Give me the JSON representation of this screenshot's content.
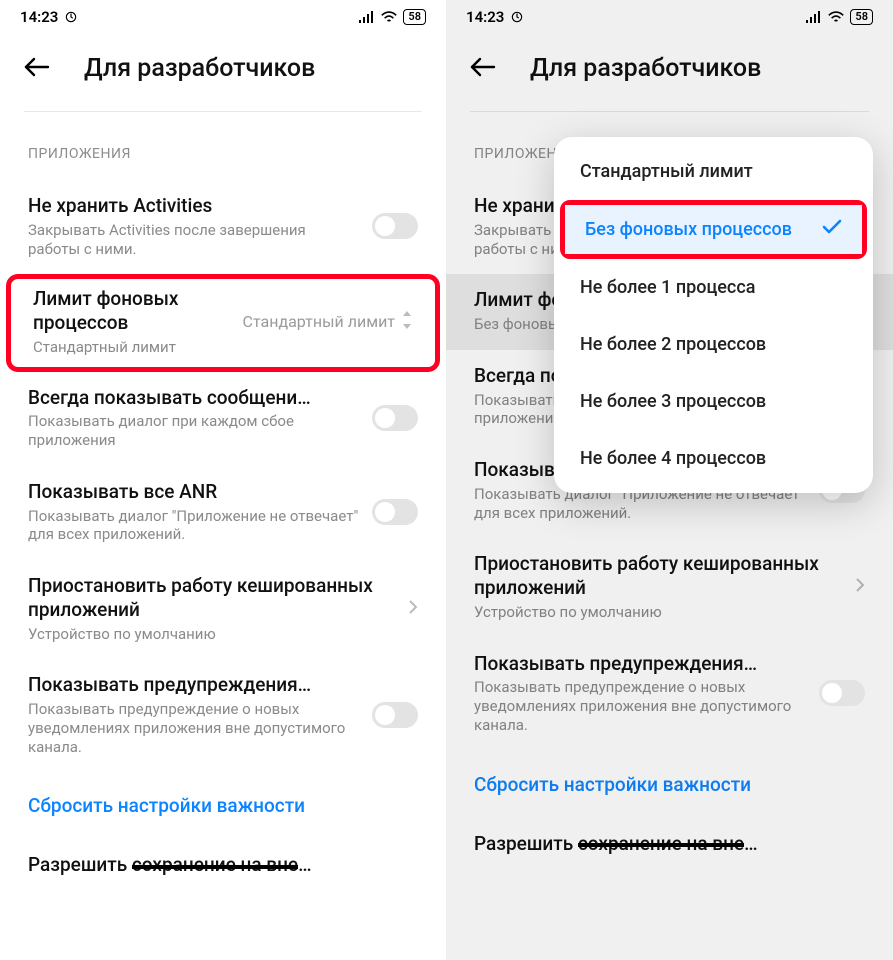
{
  "status": {
    "time": "14:23",
    "battery": "58"
  },
  "header": {
    "title": "Для разработчиков"
  },
  "section_label": "ПРИЛОЖЕНИЯ",
  "left": {
    "items": {
      "activities": {
        "title": "Не хранить Activities",
        "sub": "Закрывать Activities после завершения работы с ними."
      },
      "bg_limit": {
        "title": "Лимит фоновых процессов",
        "sub": "Стандартный лимит",
        "value": "Стандартный лимит"
      },
      "crash": {
        "title": "Всегда показывать сообщени…",
        "sub": "Показывать диалог при каждом сбое приложения"
      },
      "anr": {
        "title": "Показывать все ANR",
        "sub": "Показывать диалог \"Приложение не отвечает\" для всех приложений."
      },
      "suspend": {
        "title": "Приостановить работу кешированных приложений",
        "sub": "Устройство по умолчанию"
      },
      "warnings": {
        "title": "Показывать предупреждения…",
        "sub": "Показывать предупреждение о новых уведомлениях приложения вне допустимого канала."
      },
      "reset": {
        "title": "Сбросить настройки важности"
      },
      "allow_save": {
        "title_a": "Разрешить ",
        "title_b": "сохранение на вне",
        "title_c": "…"
      }
    }
  },
  "right": {
    "bg_limit_sub": "Без фоновых процессов"
  },
  "popup": {
    "options": [
      "Стандартный лимит",
      "Без фоновых процессов",
      "Не более 1 процесса",
      "Не более 2 процессов",
      "Не более 3 процессов",
      "Не более 4 процессов"
    ],
    "selected_index": 1
  }
}
